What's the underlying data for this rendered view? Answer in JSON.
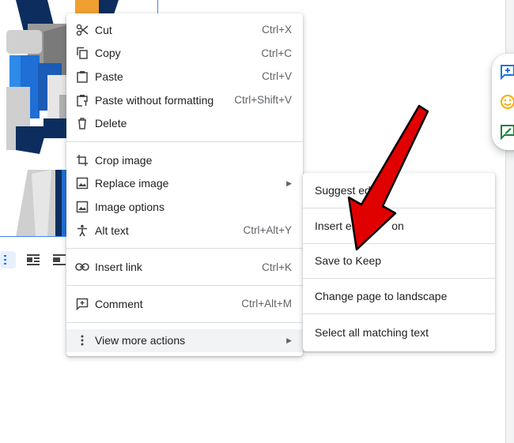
{
  "context_menu": {
    "items": [
      {
        "label": "Cut",
        "shortcut": "Ctrl+X",
        "icon": "scissors-icon"
      },
      {
        "label": "Copy",
        "shortcut": "Ctrl+C",
        "icon": "copy-icon"
      },
      {
        "label": "Paste",
        "shortcut": "Ctrl+V",
        "icon": "clipboard-icon"
      },
      {
        "label": "Paste without formatting",
        "shortcut": "Ctrl+Shift+V",
        "icon": "paste-plain-icon"
      },
      {
        "label": "Delete",
        "shortcut": "",
        "icon": "trash-icon"
      },
      {
        "label": "Crop image",
        "shortcut": "",
        "icon": "crop-icon"
      },
      {
        "label": "Replace image",
        "shortcut": "",
        "icon": "image-icon",
        "submenu": true
      },
      {
        "label": "Image options",
        "shortcut": "",
        "icon": "image-options-icon"
      },
      {
        "label": "Alt text",
        "shortcut": "Ctrl+Alt+Y",
        "icon": "accessibility-icon"
      },
      {
        "label": "Insert link",
        "shortcut": "Ctrl+K",
        "icon": "link-icon"
      },
      {
        "label": "Comment",
        "shortcut": "Ctrl+Alt+M",
        "icon": "add-comment-icon"
      },
      {
        "label": "View more actions",
        "shortcut": "",
        "icon": "more-vert-icon",
        "submenu": true,
        "highlighted": true
      }
    ]
  },
  "submenu": {
    "items": [
      {
        "label": "Suggest edits"
      },
      {
        "label": "Insert em          on"
      },
      {
        "label": "Save to Keep"
      },
      {
        "label": "Change page to landscape"
      },
      {
        "label": "Select all matching text"
      }
    ]
  },
  "colors": {
    "accent_blue": "#1a73e8",
    "emoji_yellow": "#f9ab00",
    "suggest_green": "#188038",
    "annotation_red": "#e00000",
    "menu_highlight": "#f1f3f4"
  }
}
